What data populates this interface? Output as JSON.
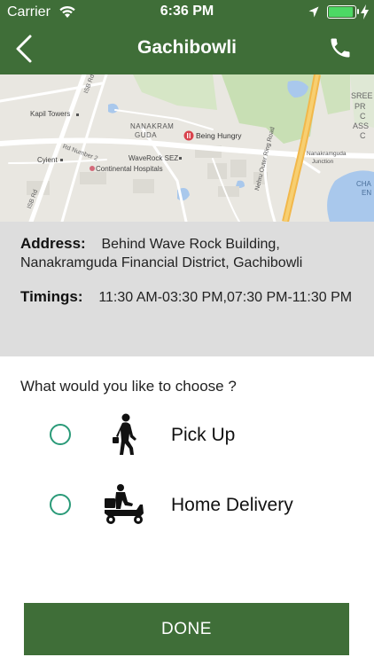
{
  "status_bar": {
    "carrier": "Carrier",
    "time": "6:36 PM"
  },
  "nav": {
    "title": "Gachibowli",
    "back_icon": "chevron-left-icon",
    "call_icon": "phone-icon"
  },
  "map": {
    "labels": {
      "kapil": "Kapil Towers",
      "nanakramguda": "NANAKRAM",
      "guda": "GUDA",
      "being_hungry": "Being Hungry",
      "cyient": "Cyient",
      "waverock": "WaveRock SEZ",
      "continental": "Continental Hospitals",
      "outer_ring": "Nehru Outer Ring Road",
      "nanakramguda_junction_1": "Nanakramguda",
      "nanakramguda_junction_2": "Junction",
      "sree": "SREE",
      "pr": "PR",
      "c": "C",
      "ass": "ASS",
      "c2": "C",
      "cha": "CHA",
      "en": "EN",
      "rd_number_2": "Rd Number 2",
      "isb_rd": "ISB Rd",
      "isb_rd_2": "ISB Rd"
    }
  },
  "info": {
    "address_label": "Address:",
    "address_text": "Behind Wave Rock Building, Nanakramguda Financial District, Gachibowli",
    "timings_label": "Timings:",
    "timings_text": "11:30 AM-03:30 PM,07:30 PM-11:30 PM"
  },
  "choice": {
    "question": "What would you like to choose ?",
    "options": [
      {
        "label": "Pick Up",
        "icon": "walking-person-icon"
      },
      {
        "label": "Home Delivery",
        "icon": "delivery-scooter-icon"
      }
    ]
  },
  "done_label": "DONE",
  "colors": {
    "header_green": "#3f6e38",
    "radio_teal": "#2a9a78",
    "info_gray": "#dddddd"
  }
}
